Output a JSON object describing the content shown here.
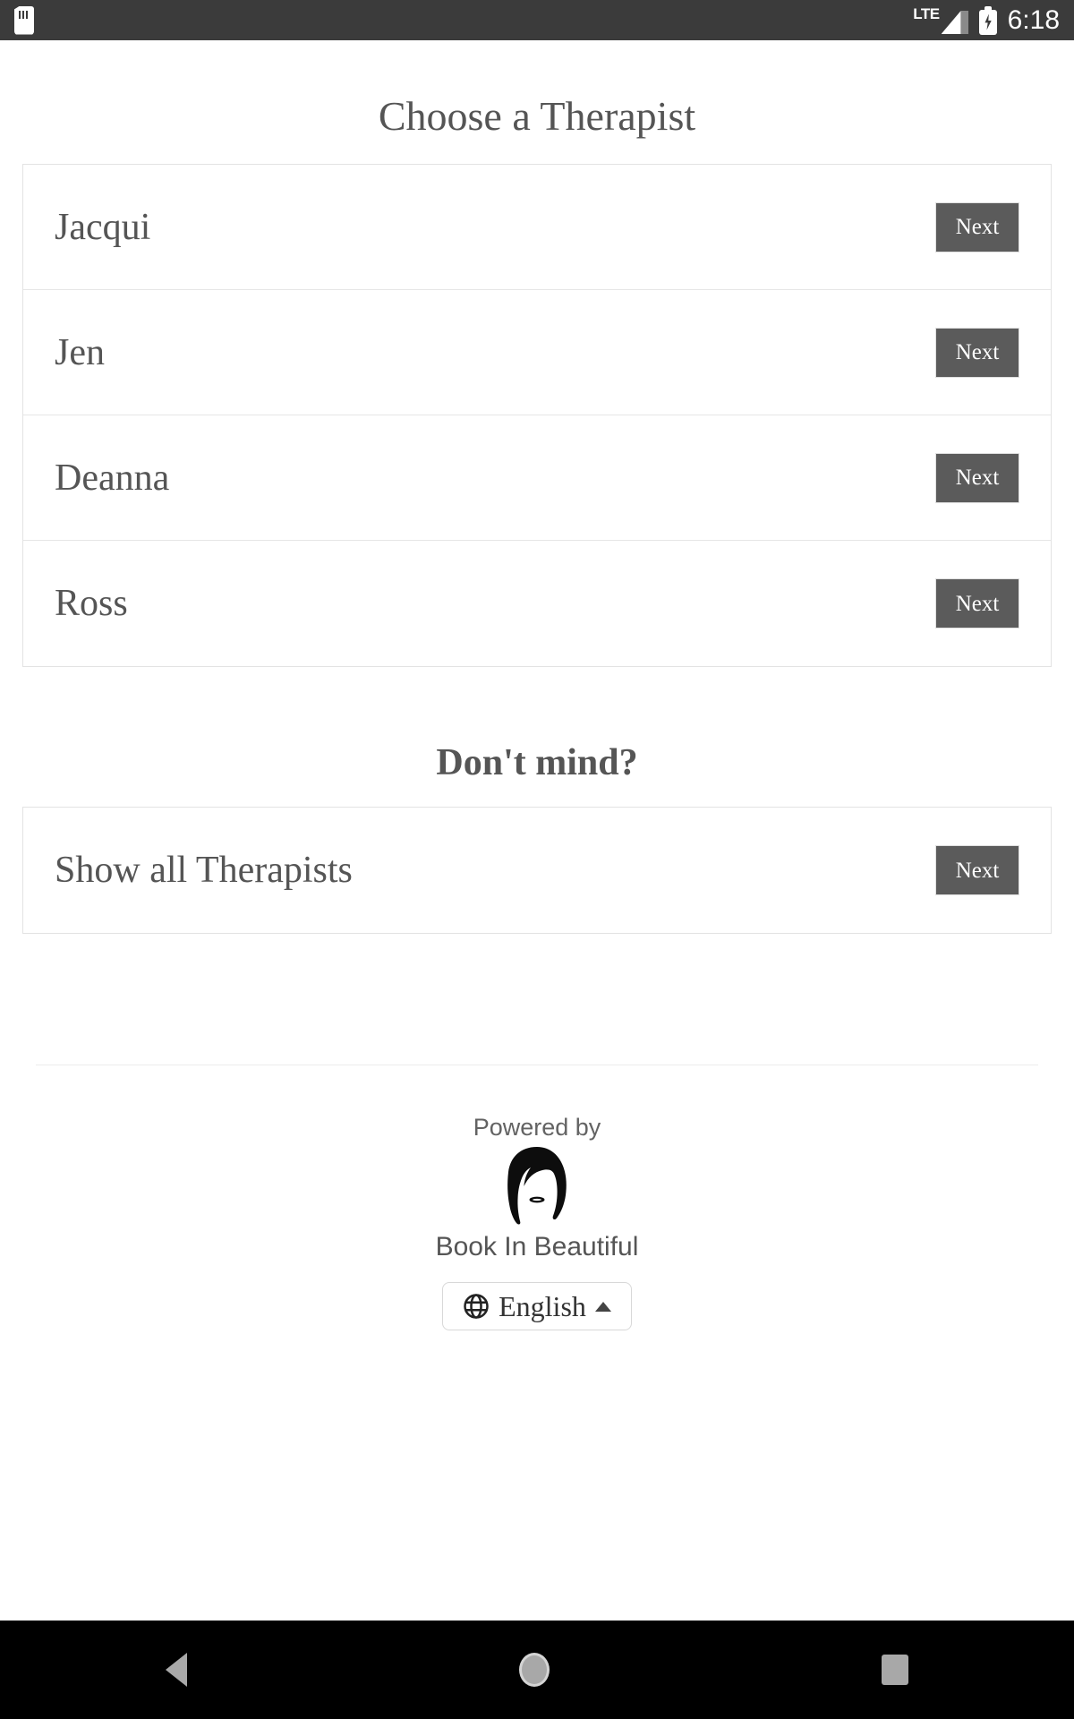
{
  "status_bar": {
    "sdcard_icon": "sdcard-icon",
    "network_label": "LTE",
    "signal_icon": "signal-bars-icon",
    "battery_icon": "battery-charging-icon",
    "time": "6:18"
  },
  "page": {
    "title": "Choose a Therapist",
    "subheading": "Don't mind?",
    "next_label": "Next"
  },
  "therapists": [
    {
      "name": "Jacqui",
      "action": "Next"
    },
    {
      "name": "Jen",
      "action": "Next"
    },
    {
      "name": "Deanna",
      "action": "Next"
    },
    {
      "name": "Ross",
      "action": "Next"
    }
  ],
  "show_all": {
    "label": "Show all Therapists",
    "action": "Next"
  },
  "footer": {
    "powered_by": "Powered by",
    "brand": "Book In Beautiful",
    "logo_icon": "woman-silhouette-logo",
    "language": {
      "globe_icon": "globe-icon",
      "value": "English",
      "caret_icon": "caret-up-icon"
    }
  },
  "nav_bar": {
    "back": "back-icon",
    "home": "home-icon",
    "recents": "recents-icon"
  },
  "colors": {
    "status_bar_bg": "#3b3b3b",
    "next_button_bg": "#5b5b5b",
    "text": "#555555",
    "border": "#e3e3e3",
    "nav_bar_bg": "#000000"
  }
}
